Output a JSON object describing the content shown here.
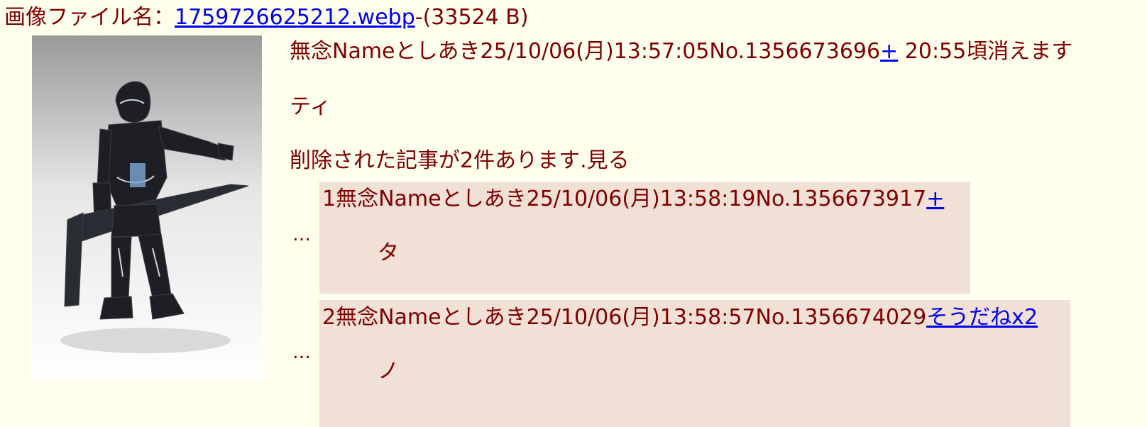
{
  "file": {
    "label": "画像ファイル名：",
    "filename": "1759726625212.webp",
    "size": "-(33524 B)"
  },
  "op": {
    "name_label": "無念",
    "name": "Name",
    "author": "としあき",
    "datetime": "25/10/06(月)13:57:05",
    "number": "No.1356673696",
    "plus": "+",
    "expire": " 20:55頃消えます",
    "body": "ティ"
  },
  "deleted": {
    "text": "削除された記事が2件あります.",
    "link": "見る"
  },
  "replies": [
    {
      "ellipsis": "…",
      "index": "1",
      "name_label": "無念",
      "name": "Name",
      "author": "としあき",
      "datetime": "25/10/06(月)13:58:19",
      "number": "No.1356673917",
      "action": "+",
      "body": "タ"
    },
    {
      "ellipsis": "…",
      "index": "2",
      "name_label": "無念",
      "name": "Name",
      "author": "としあき",
      "datetime": "25/10/06(月)13:58:57",
      "number": "No.1356674029",
      "action": "そうだねx2",
      "body": "ノ"
    }
  ],
  "icons": {
    "thumbnail": "robot-figure-image"
  }
}
